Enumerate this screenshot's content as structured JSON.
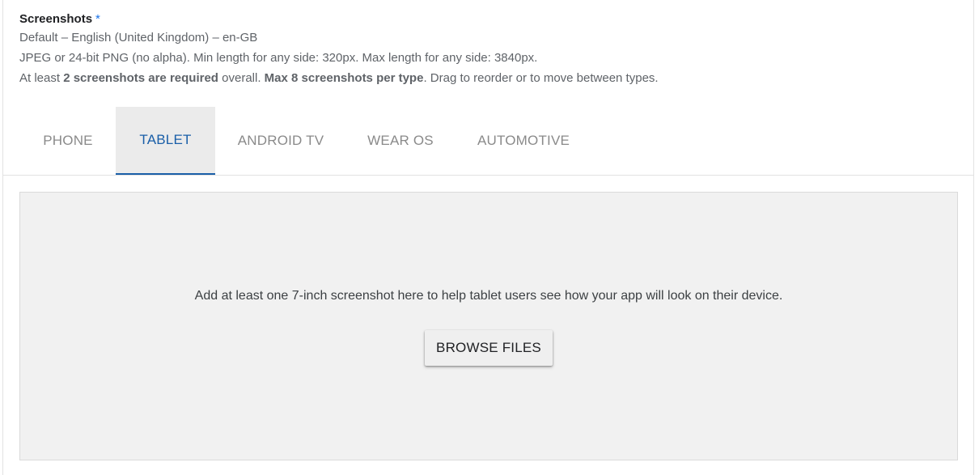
{
  "section": {
    "title": "Screenshots",
    "required_marker": "*",
    "language_line": "Default – English (United Kingdom) – en-GB",
    "format_line": "JPEG or 24-bit PNG (no alpha). Min length for any side: 320px. Max length for any side: 3840px.",
    "requirements": {
      "prefix": "At least ",
      "bold_required": "2 screenshots are required",
      "middle": " overall. ",
      "bold_max": "Max 8 screenshots per type",
      "suffix": ". Drag to reorder or to move between types."
    }
  },
  "tabs": [
    {
      "label": "PHONE",
      "active": false
    },
    {
      "label": "TABLET",
      "active": true
    },
    {
      "label": "ANDROID TV",
      "active": false
    },
    {
      "label": "WEAR OS",
      "active": false
    },
    {
      "label": "AUTOMOTIVE",
      "active": false
    }
  ],
  "dropzone": {
    "message": "Add at least one 7-inch screenshot here to help tablet users see how your app will look on their device.",
    "browse_label": "BROWSE FILES"
  },
  "colors": {
    "accent": "#1a5fa8",
    "required_star": "#1a73e8",
    "tab_inactive": "#8a8a8a",
    "dropzone_bg": "#f1f1f1"
  }
}
